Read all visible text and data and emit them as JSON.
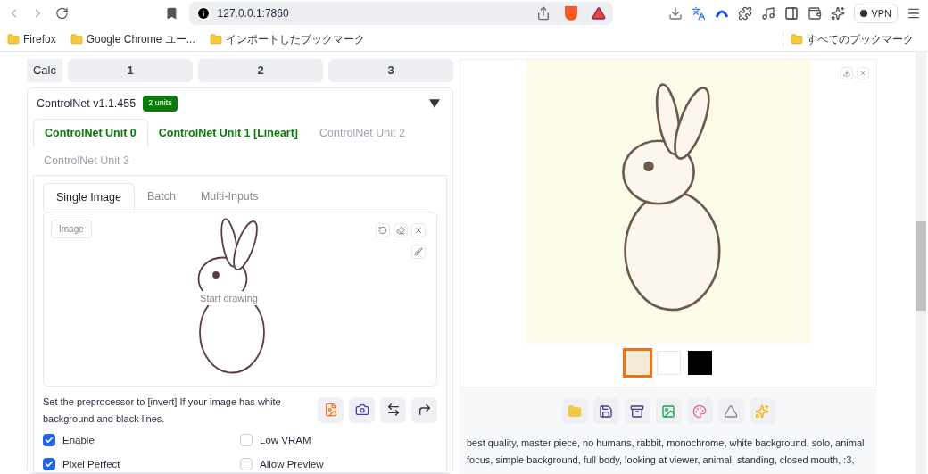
{
  "browser": {
    "url": "127.0.0.1:7860",
    "vpn": "VPN"
  },
  "bookmarks": [
    {
      "label": "Firefox"
    },
    {
      "label": "Google Chrome ユー..."
    },
    {
      "label": "インポートしたブックマーク"
    }
  ],
  "all_bookmarks": "すべてのブックマーク",
  "calc": {
    "label": "Calc",
    "buttons": [
      "1",
      "2",
      "3"
    ]
  },
  "controlnet": {
    "title": "ControlNet v1.1.455",
    "badge": "2 units",
    "units": [
      {
        "label": "ControlNet Unit 0",
        "selected": true,
        "enabled": true
      },
      {
        "label": "ControlNet Unit 1 [Lineart]",
        "selected": false,
        "enabled": true
      },
      {
        "label": "ControlNet Unit 2",
        "selected": false,
        "enabled": false
      },
      {
        "label": "ControlNet Unit 3",
        "selected": false,
        "enabled": false
      }
    ],
    "input_tabs": [
      {
        "label": "Single Image",
        "selected": true
      },
      {
        "label": "Batch",
        "selected": false
      },
      {
        "label": "Multi-Inputs",
        "selected": false
      }
    ],
    "canvas": {
      "label": "Image",
      "placeholder": "Start drawing"
    },
    "hint": "Set the preprocessor to [invert] If your image has white background and black lines.",
    "options": [
      {
        "label": "Enable",
        "checked": true
      },
      {
        "label": "Low VRAM",
        "checked": false
      },
      {
        "label": "Pixel Perfect",
        "checked": true
      },
      {
        "label": "Allow Preview",
        "checked": false
      }
    ]
  },
  "gallery": {
    "thumbnails": [
      {
        "kind": "color",
        "selected": true
      },
      {
        "kind": "lineart",
        "selected": false
      },
      {
        "kind": "dark",
        "selected": false
      }
    ],
    "prompt": "best quality, master piece, no humans, rabbit, monochrome, white background, solo, animal focus, simple background, full body, looking at viewer, animal, standing, closed mouth, :3,"
  }
}
